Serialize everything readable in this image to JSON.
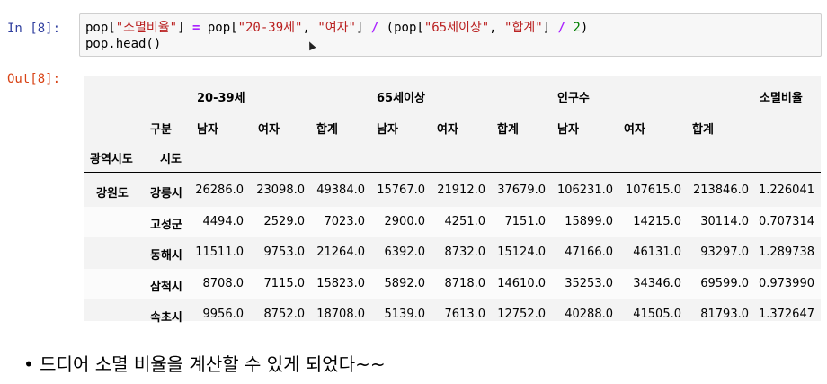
{
  "input_prompt": "In [8]:",
  "output_prompt": "Out[8]:",
  "code": {
    "line1": [
      {
        "t": "pop[",
        "c": ""
      },
      {
        "t": "\"소멸비율\"",
        "c": "str"
      },
      {
        "t": "] ",
        "c": ""
      },
      {
        "t": "=",
        "c": "op"
      },
      {
        "t": " pop[",
        "c": ""
      },
      {
        "t": "\"20-39세\"",
        "c": "str"
      },
      {
        "t": ", ",
        "c": ""
      },
      {
        "t": "\"여자\"",
        "c": "str"
      },
      {
        "t": "] ",
        "c": ""
      },
      {
        "t": "/",
        "c": "op"
      },
      {
        "t": " (pop[",
        "c": ""
      },
      {
        "t": "\"65세이상\"",
        "c": "str"
      },
      {
        "t": ", ",
        "c": ""
      },
      {
        "t": "\"합계\"",
        "c": "str"
      },
      {
        "t": "] ",
        "c": ""
      },
      {
        "t": "/",
        "c": "op"
      },
      {
        "t": " ",
        "c": ""
      },
      {
        "t": "2",
        "c": "num"
      },
      {
        "t": ")",
        "c": ""
      }
    ],
    "line2": "pop.head()"
  },
  "table": {
    "top_headers": [
      "20-39세",
      "65세이상",
      "인구수",
      "소멸비율"
    ],
    "sub_label": "구분",
    "sub_headers": [
      "남자",
      "여자",
      "합계",
      "남자",
      "여자",
      "합계",
      "남자",
      "여자",
      "합계"
    ],
    "index_names": [
      "광역시도",
      "시도"
    ],
    "group_label": "강원도",
    "rows": [
      {
        "city": "강릉시",
        "values": [
          "26286.0",
          "23098.0",
          "49384.0",
          "15767.0",
          "21912.0",
          "37679.0",
          "106231.0",
          "107615.0",
          "213846.0",
          "1.226041"
        ]
      },
      {
        "city": "고성군",
        "values": [
          "4494.0",
          "2529.0",
          "7023.0",
          "2900.0",
          "4251.0",
          "7151.0",
          "15899.0",
          "14215.0",
          "30114.0",
          "0.707314"
        ]
      },
      {
        "city": "동해시",
        "values": [
          "11511.0",
          "9753.0",
          "21264.0",
          "6392.0",
          "8732.0",
          "15124.0",
          "47166.0",
          "46131.0",
          "93297.0",
          "1.289738"
        ]
      },
      {
        "city": "삼척시",
        "values": [
          "8708.0",
          "7115.0",
          "15823.0",
          "5892.0",
          "8718.0",
          "14610.0",
          "35253.0",
          "34346.0",
          "69599.0",
          "0.973990"
        ]
      },
      {
        "city": "속초시",
        "values": [
          "9956.0",
          "8752.0",
          "18708.0",
          "5139.0",
          "7613.0",
          "12752.0",
          "40288.0",
          "41505.0",
          "81793.0",
          "1.372647"
        ]
      }
    ]
  },
  "note": "• 드디어 소멸 비율을 계산할 수 있게 되었다~~"
}
